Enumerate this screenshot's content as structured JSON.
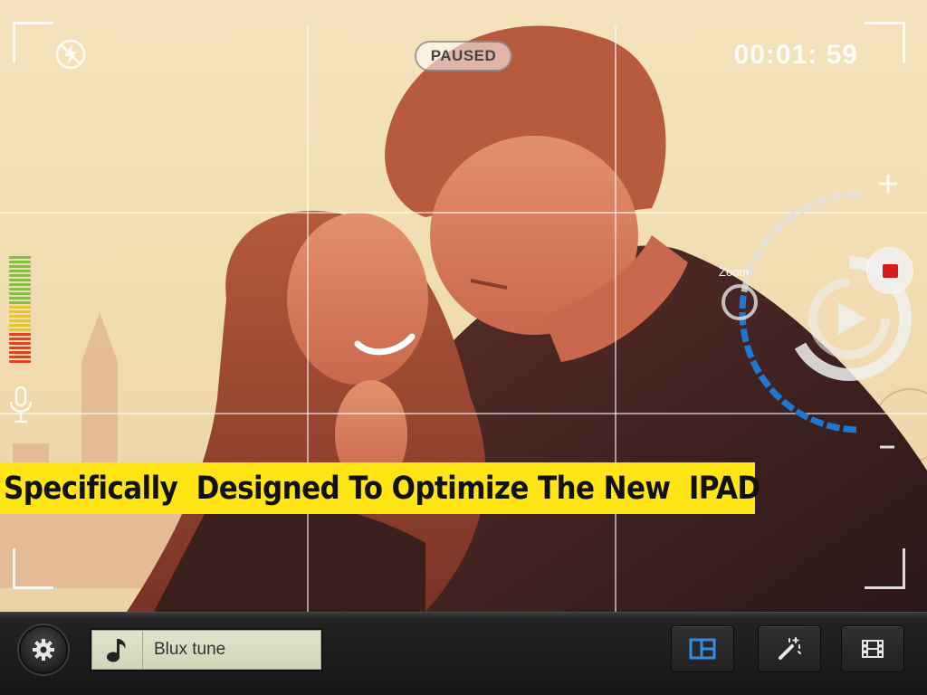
{
  "status": {
    "paused_label": "PAUSED",
    "timer": "00:01: 59"
  },
  "zoom": {
    "label": "Zoom",
    "plus_symbol": "+",
    "minus_symbol": "–"
  },
  "banner": {
    "text": "Specifically  Designed To Optimize The New  IPAD"
  },
  "toolbar": {
    "music_track": "Blux tune"
  },
  "icons": {
    "flash": "flash-off-icon",
    "mic": "microphone-icon",
    "settings": "gear-icon",
    "music": "music-note-icon",
    "layout": "grid-layout-icon",
    "effects": "magic-wand-icon",
    "film": "film-strip-icon",
    "record": "stop-record-icon",
    "play": "play-icon"
  },
  "colors": {
    "banner": "#ffe516",
    "record": "#d41a1a",
    "zoom_active": "#1e78d2",
    "layout_icon": "#2f8fe0"
  },
  "audio_level": {
    "bars": 24,
    "active_fraction": 1.0
  }
}
